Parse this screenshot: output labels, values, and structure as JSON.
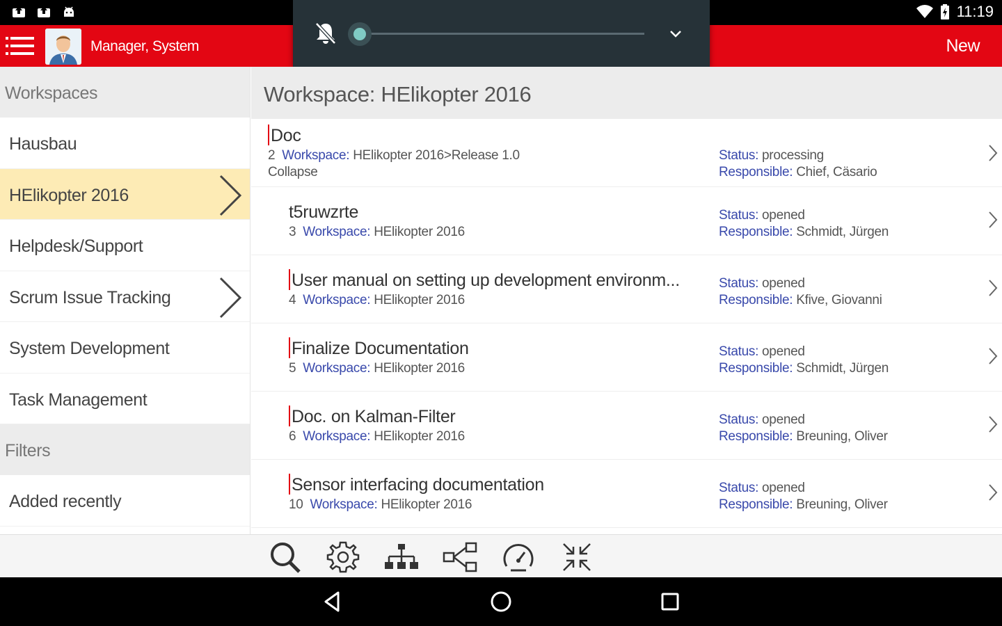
{
  "status_bar": {
    "time": "11:19",
    "left_icons": [
      "upload-icon",
      "upload-icon",
      "android-icon"
    ],
    "right_icons": [
      "wifi-icon",
      "battery-icon"
    ]
  },
  "app_bar": {
    "user_name": "Manager, System",
    "new_label": "New",
    "color": "#e30613"
  },
  "volume_panel": {
    "level": 0,
    "icons": [
      "bell-off-icon",
      "chevron-down-icon"
    ]
  },
  "sidebar": {
    "workspaces_header": "Workspaces",
    "workspaces": [
      {
        "label": "Hausbau"
      },
      {
        "label": "HElikopter 2016"
      },
      {
        "label": "Helpdesk/Support"
      },
      {
        "label": "Scrum Issue Tracking"
      },
      {
        "label": "System Development"
      },
      {
        "label": "Task Management"
      }
    ],
    "filters_header": "Filters",
    "filters": [
      {
        "label": "Added recently"
      }
    ]
  },
  "main": {
    "title": "Workspace: HElikopter 2016",
    "items": [
      {
        "title": "Doc",
        "id": "2",
        "workspace_label": "Workspace:",
        "workspace": "HElikopter 2016>Release 1.0",
        "extra": "Collapse",
        "status_label": "Status:",
        "status": "processing",
        "responsible_label": "Responsible:",
        "responsible": "Chief, Cäsario"
      },
      {
        "title": "t5ruwzrte",
        "id": "3",
        "workspace_label": "Workspace:",
        "workspace": "HElikopter 2016",
        "status_label": "Status:",
        "status": "opened",
        "responsible_label": "Responsible:",
        "responsible": "Schmidt, Jürgen"
      },
      {
        "title": "User manual on setting up development environm...",
        "id": "4",
        "workspace_label": "Workspace:",
        "workspace": "HElikopter 2016",
        "status_label": "Status:",
        "status": "opened",
        "responsible_label": "Responsible:",
        "responsible": "Kfive, Giovanni"
      },
      {
        "title": "Finalize Documentation",
        "id": "5",
        "workspace_label": "Workspace:",
        "workspace": "HElikopter 2016",
        "status_label": "Status:",
        "status": "opened",
        "responsible_label": "Responsible:",
        "responsible": "Schmidt, Jürgen"
      },
      {
        "title": "Doc. on Kalman-Filter",
        "id": "6",
        "workspace_label": "Workspace:",
        "workspace": "HElikopter 2016",
        "status_label": "Status:",
        "status": "opened",
        "responsible_label": "Responsible:",
        "responsible": "Breuning, Oliver"
      },
      {
        "title": "Sensor interfacing documentation",
        "id": "10",
        "workspace_label": "Workspace:",
        "workspace": "HElikopter 2016",
        "status_label": "Status:",
        "status": "opened",
        "responsible_label": "Responsible:",
        "responsible": "Breuning, Oliver"
      }
    ]
  },
  "toolbar": {
    "icons": [
      "search-icon",
      "settings-icon",
      "hierarchy-icon",
      "share-icon",
      "dashboard-icon",
      "collapse-icon"
    ]
  },
  "nav_bar": {
    "icons": [
      "back-icon",
      "home-icon",
      "recents-icon"
    ]
  }
}
